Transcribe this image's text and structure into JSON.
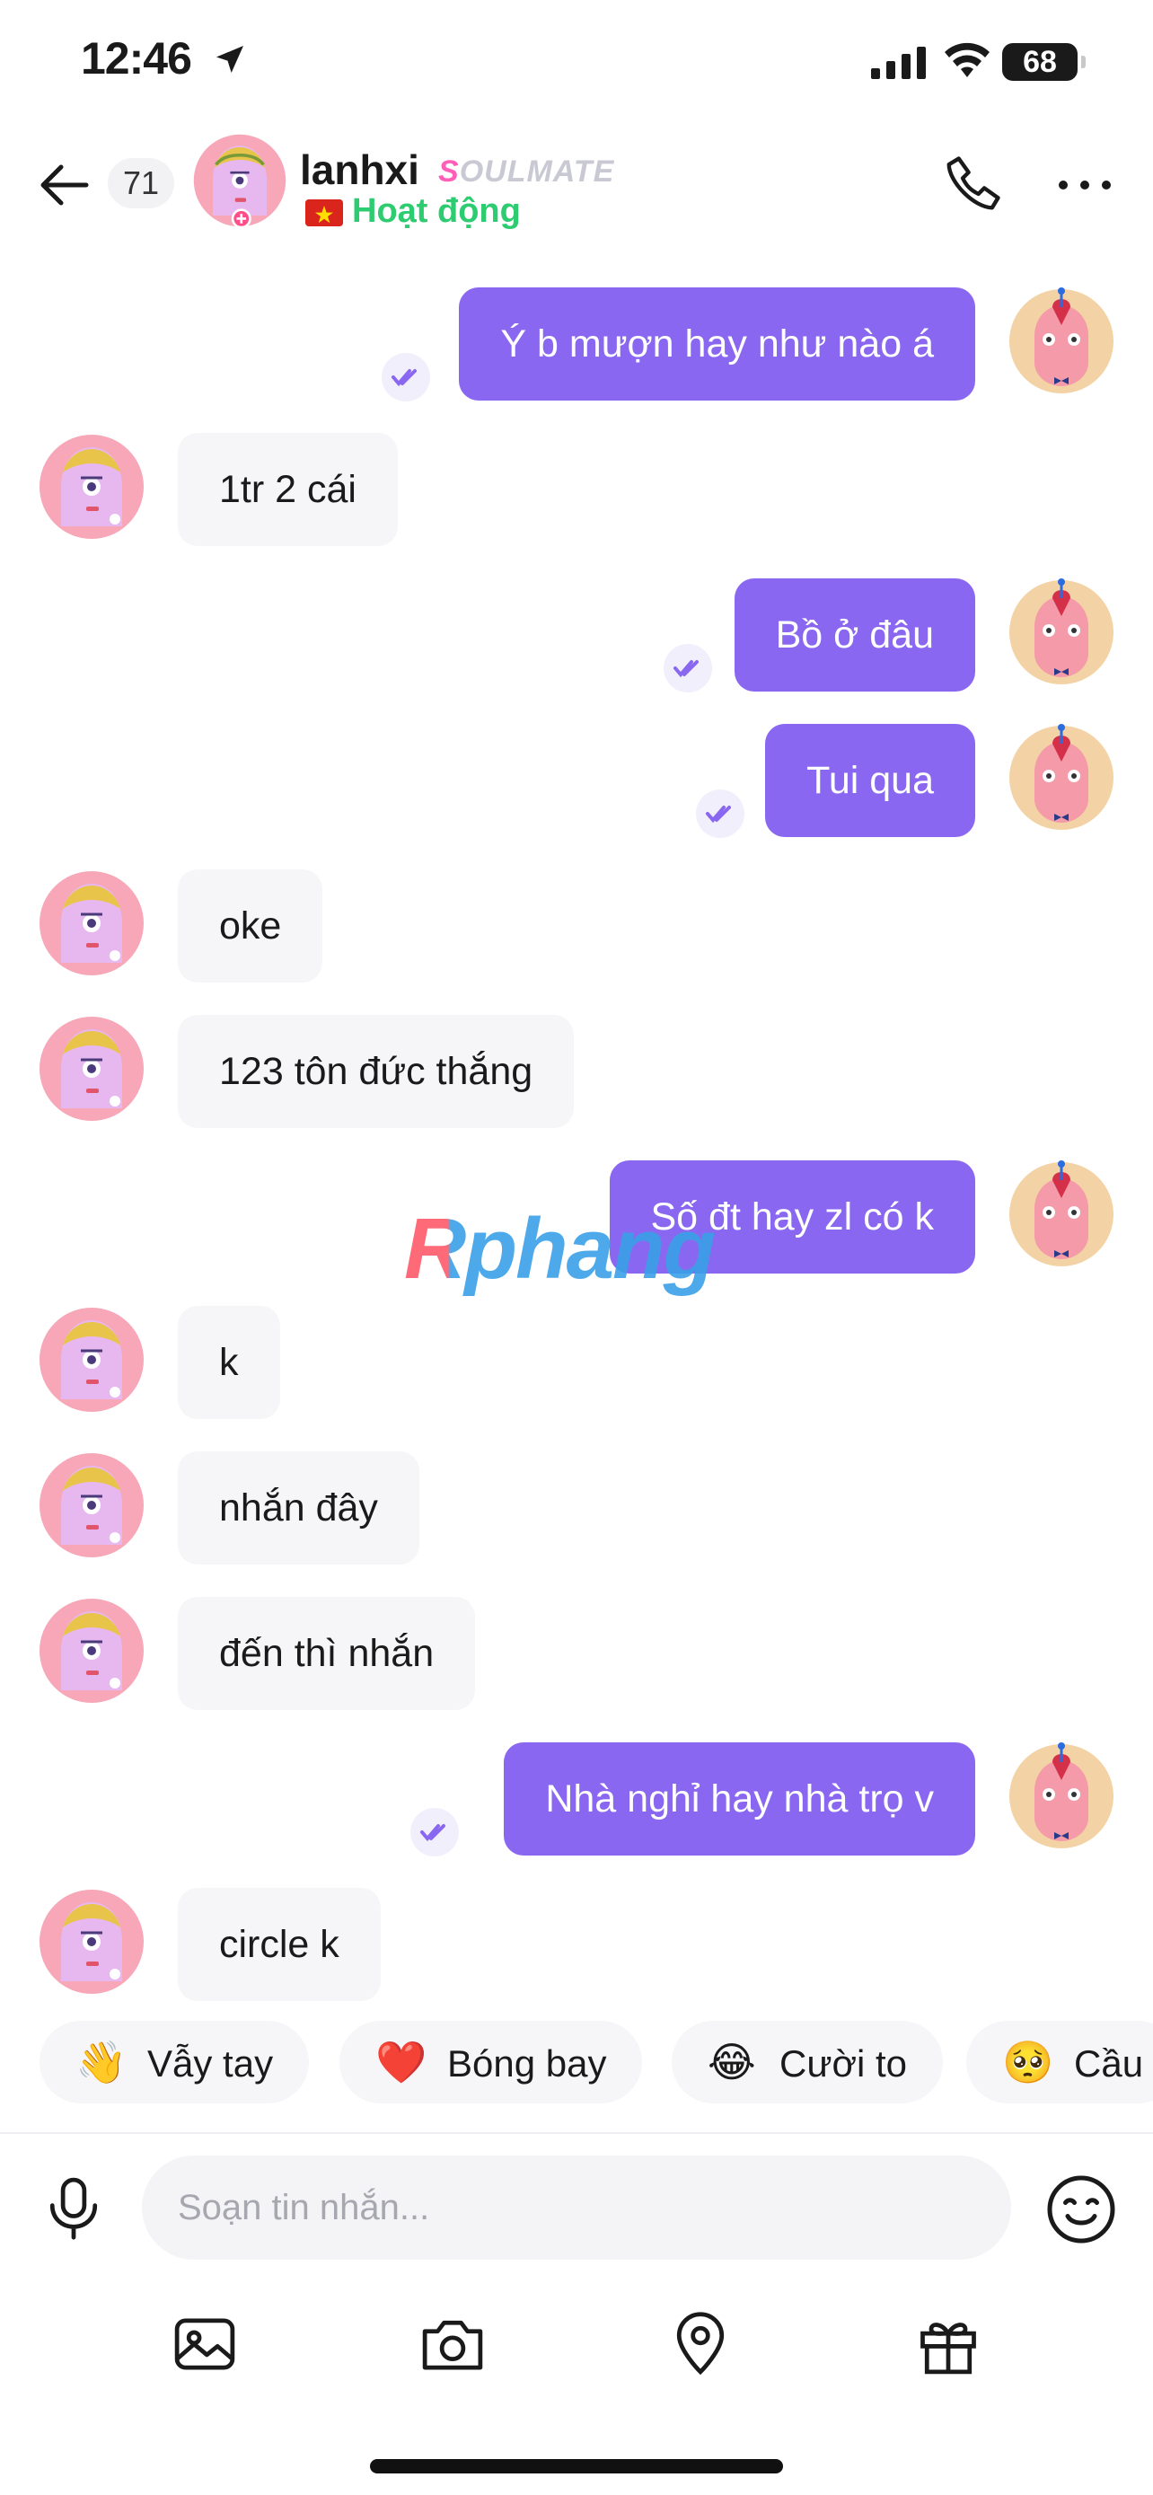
{
  "status_bar": {
    "time": "12:46",
    "battery": "68"
  },
  "header": {
    "back_count": "71",
    "name": "lanhxi",
    "tag_first": "S",
    "tag_rest": "OULMATE",
    "status": "Hoạt động"
  },
  "messages": [
    {
      "dir": "out",
      "text": "Ý b mượn hay như nào á"
    },
    {
      "dir": "in",
      "text": "1tr 2 cái"
    },
    {
      "dir": "out",
      "text": "Bồ ở đâu"
    },
    {
      "dir": "out",
      "text": "Tui qua"
    },
    {
      "dir": "in",
      "text": "oke"
    },
    {
      "dir": "in",
      "text": "123 tôn đức thắng"
    },
    {
      "dir": "out",
      "text": "Số đt hay zl có k"
    },
    {
      "dir": "in",
      "text": "k"
    },
    {
      "dir": "in",
      "text": "nhắn đây"
    },
    {
      "dir": "in",
      "text": "đến thì nhắn"
    },
    {
      "dir": "out",
      "text": "Nhà nghỉ hay nhà trọ v"
    },
    {
      "dir": "in",
      "text": "circle k"
    }
  ],
  "watermark": "Rphang",
  "reactions": [
    {
      "emoji": "👋",
      "label": "Vẫy tay"
    },
    {
      "emoji": "❤️",
      "label": "Bóng bay"
    },
    {
      "emoji": "😂",
      "label": "Cười to"
    },
    {
      "emoji": "🥺",
      "label": "Cầu"
    }
  ],
  "composer": {
    "placeholder": "Soạn tin nhắn..."
  },
  "toolbar": [
    "image-icon",
    "camera-icon",
    "location-pin-icon",
    "gift-icon"
  ],
  "colors": {
    "outgoing_bubble": "#8a67f0",
    "incoming_bubble": "#f6f6f8",
    "online": "#2ecc71",
    "soulmate_accent": "#ff5fb7"
  }
}
